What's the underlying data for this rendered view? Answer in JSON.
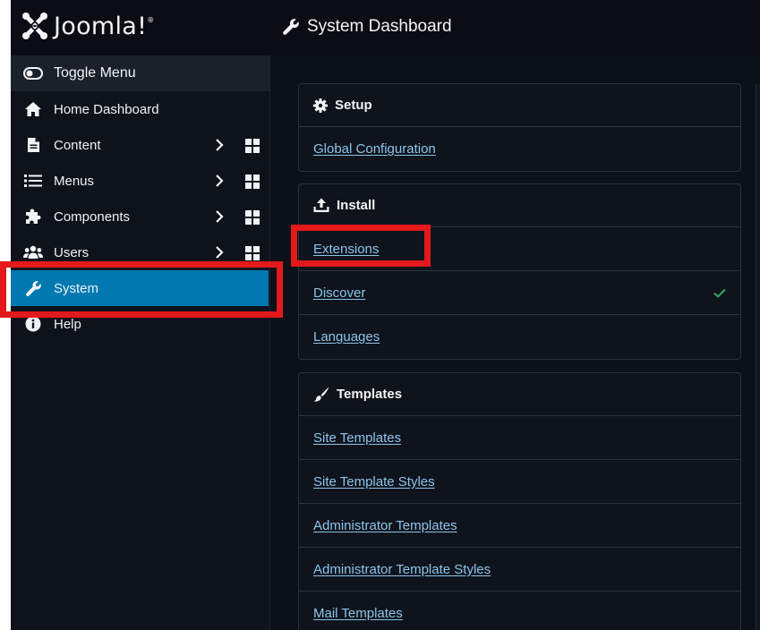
{
  "header": {
    "logo_text": "Joomla!",
    "logo_mark": "®",
    "page_title": "System Dashboard"
  },
  "sidebar": {
    "toggle_label": "Toggle Menu",
    "items": [
      {
        "label": "Home Dashboard",
        "icon": "home-icon"
      },
      {
        "label": "Content",
        "icon": "file-icon",
        "has_children": true
      },
      {
        "label": "Menus",
        "icon": "list-icon",
        "has_children": true
      },
      {
        "label": "Components",
        "icon": "puzzle-icon",
        "has_children": true
      },
      {
        "label": "Users",
        "icon": "users-icon",
        "has_children": true
      },
      {
        "label": "System",
        "icon": "wrench-icon",
        "active": true
      },
      {
        "label": "Help",
        "icon": "info-icon"
      }
    ]
  },
  "cards": {
    "setup": {
      "title": "Setup",
      "icon": "gear-icon",
      "links": [
        "Global Configuration"
      ]
    },
    "install": {
      "title": "Install",
      "icon": "upload-icon",
      "links": [
        "Extensions",
        "Discover",
        "Languages"
      ]
    },
    "templates": {
      "title": "Templates",
      "icon": "brush-icon",
      "links": [
        "Site Templates",
        "Site Template Styles",
        "Administrator Templates",
        "Administrator Template Styles",
        "Mail Templates"
      ]
    }
  },
  "colors": {
    "active": "#0079b0",
    "link": "#8cc4ec",
    "highlight": "#e3191b",
    "check": "#3aa55a"
  }
}
